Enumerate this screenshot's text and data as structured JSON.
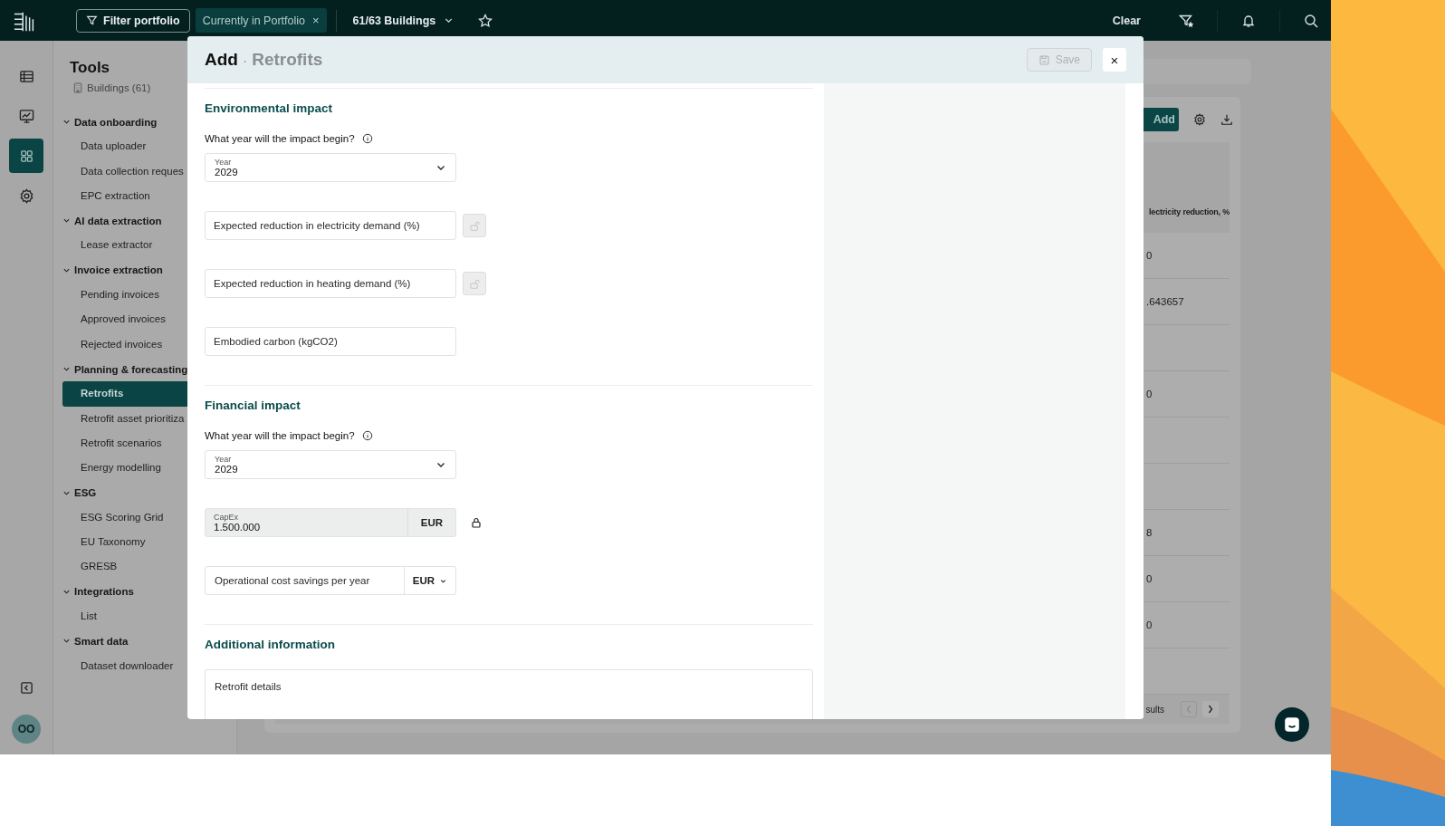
{
  "topbar": {
    "filter_button": "Filter portfolio",
    "chip": {
      "label": "Currently in Portfolio",
      "close": "×"
    },
    "buildings": "61/63 Buildings",
    "clear": "Clear"
  },
  "rail": [
    {
      "kind": "table",
      "selected": false
    },
    {
      "kind": "chart",
      "selected": false
    },
    {
      "kind": "grid",
      "selected": true
    },
    {
      "kind": "gear",
      "selected": false
    }
  ],
  "avatar": "OO",
  "sidebar": {
    "title": "Tools",
    "subtitle": "Buildings (61)",
    "groups": [
      {
        "label": "Data onboarding",
        "expanded": true,
        "children": [
          {
            "label": "Data uploader",
            "selected": false
          },
          {
            "label": "Data collection reques",
            "selected": false
          },
          {
            "label": "EPC extraction",
            "selected": false
          }
        ]
      },
      {
        "label": "AI data extraction",
        "expanded": true,
        "children": [
          {
            "label": "Lease extractor",
            "selected": false
          }
        ]
      },
      {
        "label": "Invoice extraction",
        "expanded": true,
        "children": [
          {
            "label": "Pending invoices",
            "selected": false
          },
          {
            "label": "Approved invoices",
            "selected": false
          },
          {
            "label": "Rejected invoices",
            "selected": false
          }
        ]
      },
      {
        "label": "Planning & forecasting",
        "expanded": true,
        "children": [
          {
            "label": "Retrofits",
            "selected": true
          },
          {
            "label": "Retrofit asset prioritiza",
            "selected": false
          },
          {
            "label": "Retrofit scenarios",
            "selected": false
          },
          {
            "label": "Energy modelling",
            "selected": false
          }
        ]
      },
      {
        "label": "ESG",
        "expanded": true,
        "children": [
          {
            "label": "ESG Scoring Grid",
            "selected": false
          },
          {
            "label": "EU Taxonomy",
            "selected": false
          },
          {
            "label": "GRESB",
            "selected": false
          }
        ]
      },
      {
        "label": "Integrations",
        "expanded": true,
        "children": [
          {
            "label": "List",
            "selected": false
          }
        ]
      },
      {
        "label": "Smart data",
        "expanded": true,
        "children": [
          {
            "label": "Dataset downloader",
            "selected": false
          }
        ]
      }
    ]
  },
  "background": {
    "add_button": "Add",
    "column_header": "lectricity reduction, %",
    "rows": [
      {
        "value": "0"
      },
      {
        "value": ".643657"
      },
      {},
      {
        "value": "0"
      },
      {},
      {},
      {
        "value": "8"
      },
      {
        "value": "0"
      },
      {
        "value": "0"
      },
      {}
    ],
    "footer": "sults"
  },
  "modal": {
    "title": "Add",
    "separator": "·",
    "subtitle": "Retrofits",
    "save": {
      "label": "Save",
      "disabled": true
    },
    "close": "×",
    "sections": [
      {
        "heading": "Environmental impact",
        "fields": [
          {
            "kind": "select",
            "question": "What year will the impact begin?",
            "label": "Year",
            "value": "2029"
          },
          {
            "kind": "text",
            "placeholder": "Expected reduction in electricity demand (%)",
            "lock": {
              "locked": false,
              "disabled": true
            }
          },
          {
            "kind": "text",
            "placeholder": "Expected reduction in heating demand (%)",
            "lock": {
              "locked": false,
              "disabled": true
            }
          },
          {
            "kind": "text",
            "placeholder": "Embodied carbon (kgCO2)"
          }
        ]
      },
      {
        "heading": "Financial impact",
        "fields": [
          {
            "kind": "select",
            "question": "What year will the impact begin?",
            "label": "Year",
            "value": "2029"
          },
          {
            "kind": "currency",
            "label": "CapEx",
            "value": "1.500.000",
            "currency": "EUR",
            "disabled": true,
            "lock": {
              "locked": true,
              "disabled": false
            }
          },
          {
            "kind": "currency-select",
            "placeholder": "Operational cost savings per year",
            "currency": "EUR"
          }
        ]
      },
      {
        "heading": "Additional information",
        "fields": [
          {
            "kind": "textarea",
            "placeholder": "Retrofit details"
          }
        ]
      }
    ]
  }
}
